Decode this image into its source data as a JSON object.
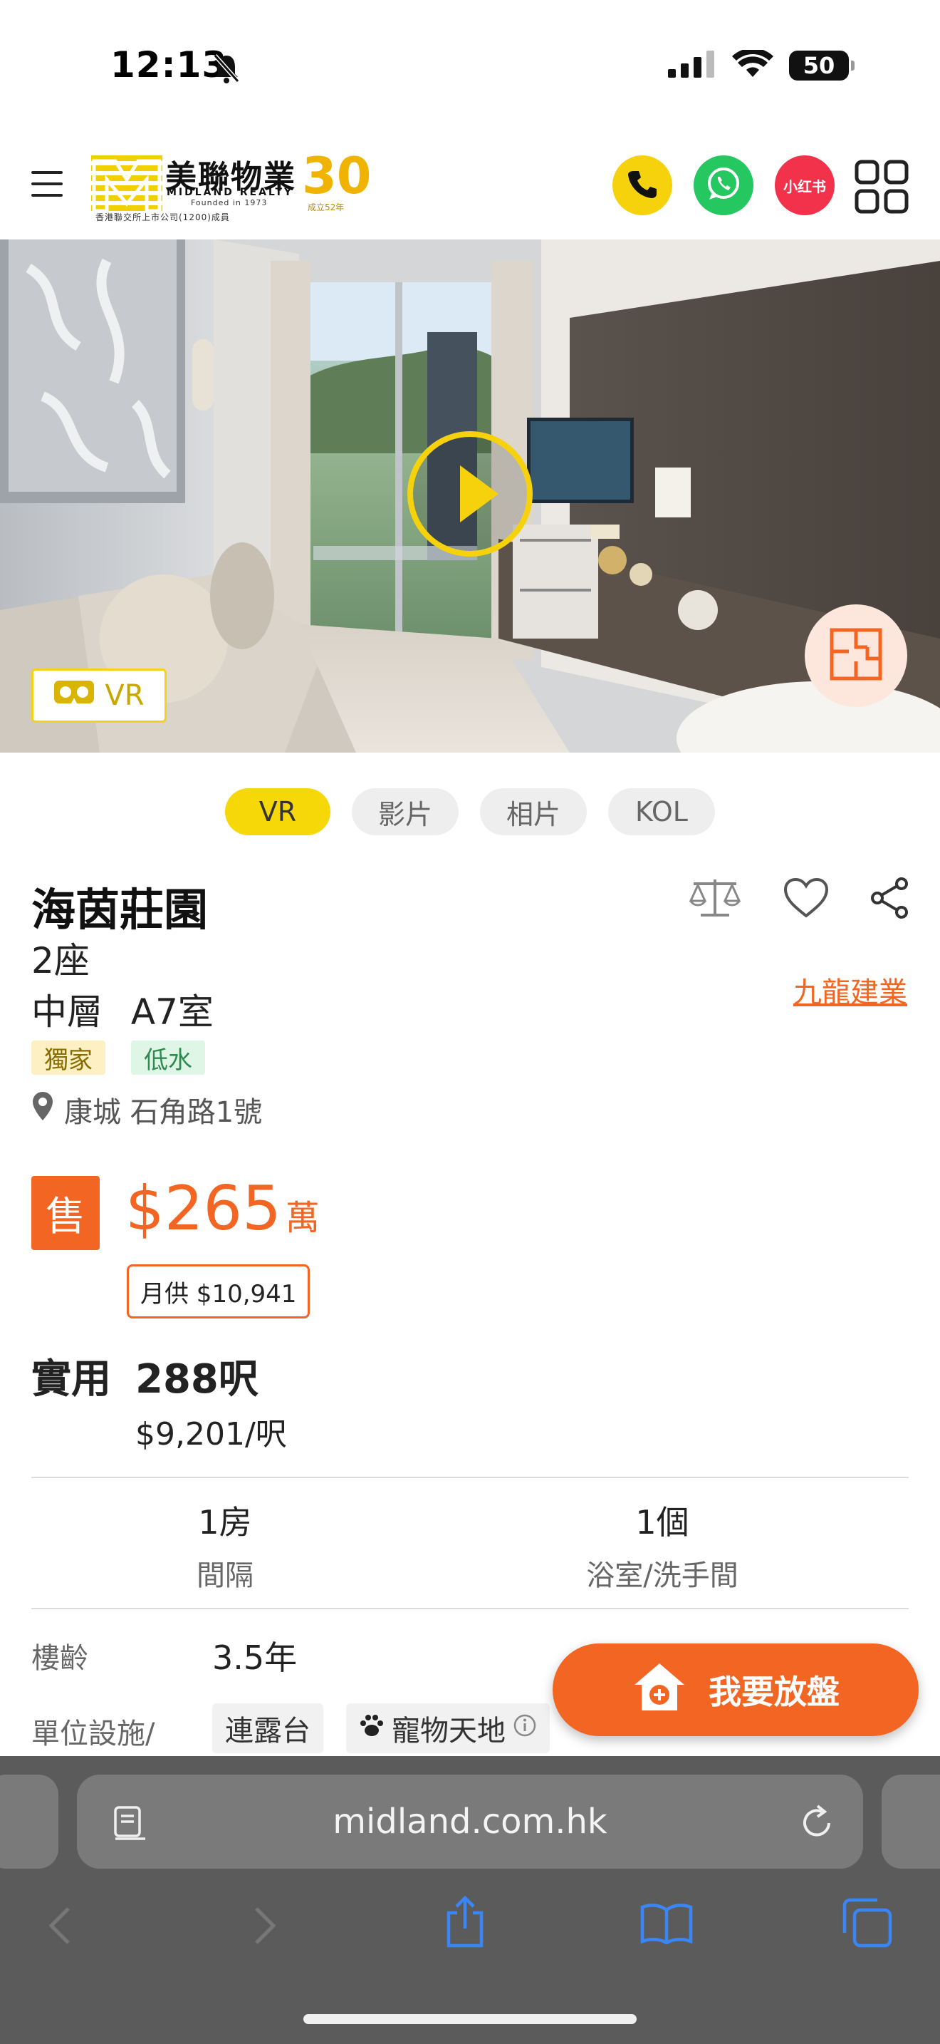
{
  "status_bar": {
    "time": "12:13",
    "battery": "50"
  },
  "header": {
    "logo_cn": "美聯物業",
    "logo_en": "MIDLAND REALTY",
    "logo_founded": "Founded in 1973",
    "logo_sub": "香港聯交所上市公司(1200)成員",
    "logo_years": "30",
    "logo_years_sub": "成立52年",
    "xhs_label": "小红书"
  },
  "hero": {
    "vr_label": "VR"
  },
  "media_tabs": [
    "VR",
    "影片",
    "相片",
    "KOL"
  ],
  "property": {
    "name": "海茵莊園",
    "block": "2座",
    "floor": "中層",
    "unit": "A7室",
    "tags": [
      "獨家",
      "低水"
    ],
    "address": "康城 石角路1號",
    "developer": "九龍建業"
  },
  "price": {
    "badge": "售",
    "value": "$265",
    "unit": "萬",
    "mortgage": "月供 $10,941"
  },
  "area": {
    "label": "實用",
    "value": "288呎",
    "per_sqft": "$9,201/呎"
  },
  "stats": [
    {
      "value": "1房",
      "label": "間隔"
    },
    {
      "value": "1個",
      "label": "浴室/洗手間"
    }
  ],
  "details": {
    "age_label": "樓齡",
    "age_value": "3.5年",
    "facility_label": "單位設施/",
    "facilities": [
      "連露台",
      "寵物天地"
    ]
  },
  "fab_label": "我要放盤",
  "browser": {
    "url": "midland.com.hk"
  },
  "colors": {
    "accent": "#f26522",
    "yellow": "#f6d708",
    "whatsapp": "#25c760",
    "xhs": "#f2314a"
  }
}
